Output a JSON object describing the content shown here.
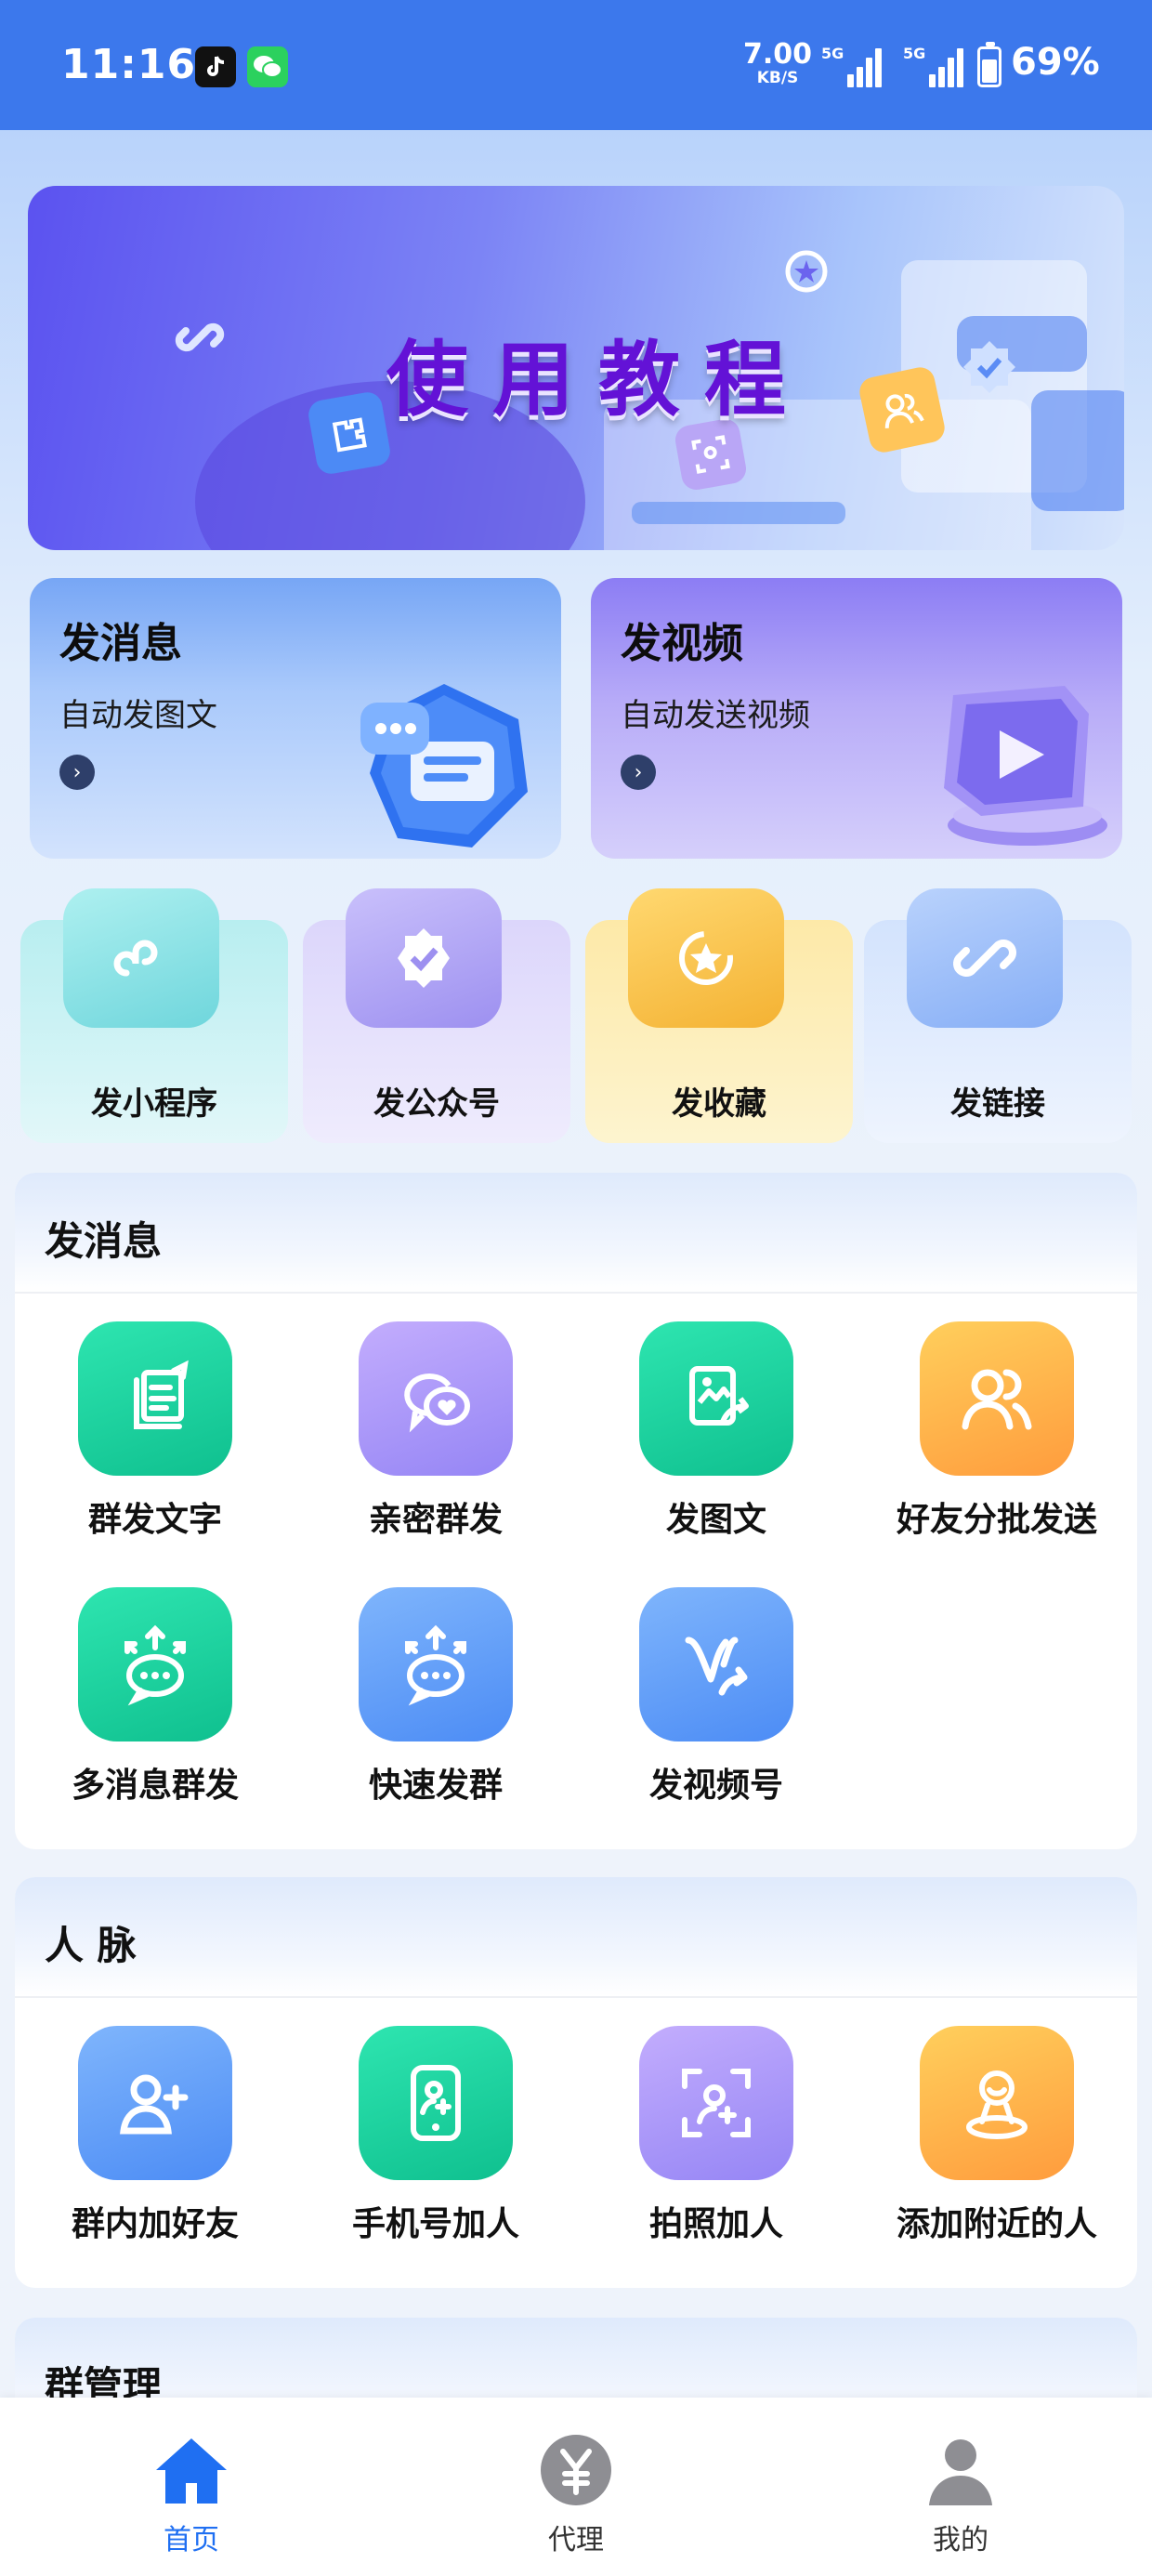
{
  "status_bar": {
    "time": "11:16",
    "net_speed": "7.00",
    "net_speed_unit": "KB/S",
    "signal1": "5G",
    "signal2": "5G",
    "battery": "69%",
    "apps": [
      "tiktok-icon",
      "wechat-icon"
    ]
  },
  "banner": {
    "title": "使用教程"
  },
  "feature_cards": [
    {
      "title": "发消息",
      "subtitle": "自动发图文",
      "icon": "chat-hexagon-icon"
    },
    {
      "title": "发视频",
      "subtitle": "自动发送视频",
      "icon": "video-play-icon"
    }
  ],
  "mini_cards": [
    {
      "label": "发小程序",
      "icon": "mini-program-icon"
    },
    {
      "label": "发公众号",
      "icon": "official-account-icon"
    },
    {
      "label": "发收藏",
      "icon": "favorite-icon"
    },
    {
      "label": "发链接",
      "icon": "link-icon"
    }
  ],
  "send_section": {
    "title": "发消息",
    "items": [
      {
        "label": "群发文字",
        "icon": "edit-text-icon"
      },
      {
        "label": "亲密群发",
        "icon": "heart-chat-icon"
      },
      {
        "label": "发图文",
        "icon": "image-share-icon"
      },
      {
        "label": "好友分批发送",
        "icon": "friends-icon"
      },
      {
        "label": "多消息群发",
        "icon": "multi-message-icon"
      },
      {
        "label": "快速发群",
        "icon": "quick-group-icon"
      },
      {
        "label": "发视频号",
        "icon": "channels-icon"
      }
    ]
  },
  "contacts_section": {
    "title": "人 脉",
    "items": [
      {
        "label": "群内加好友",
        "icon": "add-user-icon"
      },
      {
        "label": "手机号加人",
        "icon": "phone-add-icon"
      },
      {
        "label": "拍照加人",
        "icon": "scan-person-icon"
      },
      {
        "label": "添加附近的人",
        "icon": "nearby-person-icon"
      }
    ]
  },
  "group_section": {
    "title": "群管理"
  },
  "tab_bar": [
    {
      "label": "首页",
      "icon": "home-icon",
      "active": true
    },
    {
      "label": "代理",
      "icon": "yuan-icon",
      "active": false
    },
    {
      "label": "我的",
      "icon": "profile-icon",
      "active": false
    }
  ],
  "colors": {
    "status_bar": "#3c78ec",
    "accent": "#1f6ff2",
    "banner_title": "#6312d6"
  }
}
